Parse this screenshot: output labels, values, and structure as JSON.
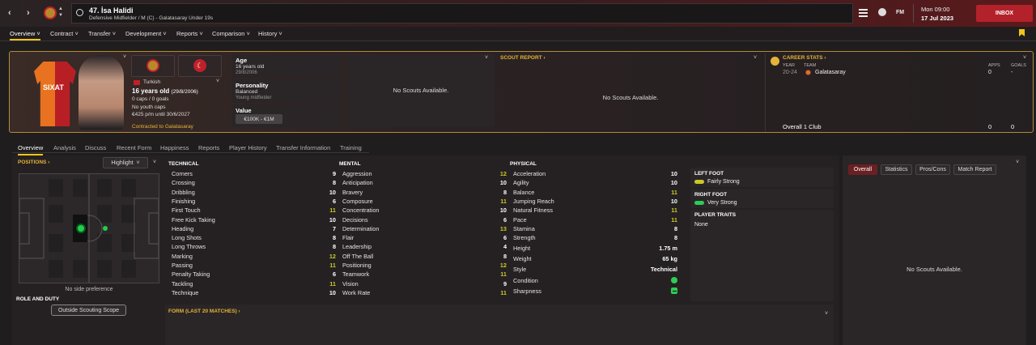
{
  "header": {
    "title": "47. İsa Halidi",
    "subtitle": "Defensive Midfielder / M (C) - Galatasaray Under 19s",
    "time": "Mon 09:00",
    "date": "17 Jul 2023",
    "inbox": "INBOX",
    "fm": "FM"
  },
  "menu": [
    "Overview",
    "Contract",
    "Transfer",
    "Development",
    "Reports",
    "Comparison",
    "History"
  ],
  "profile": {
    "nationality": "Turkish",
    "age_line": "16 years old",
    "dob_paren": "(29/8/2006)",
    "caps": "0 caps / 0 goals",
    "youth_caps": "No youth caps",
    "wage": "€425 p/m until 30/6/2027",
    "contract": "Contracted to Galatasaray",
    "shirt_text": "SIXAT"
  },
  "info": {
    "age_label": "Age",
    "age": "16 years old",
    "dob": "29/8/2006",
    "personality_label": "Personality",
    "personality": "Balanced",
    "personality_sub": "Young midfielder",
    "value_label": "Value",
    "value": "€100K - €1M"
  },
  "scouts": {
    "no_scouts": "No Scouts Available.",
    "scout_report": "SCOUT REPORT",
    "no_scouts2": "No Scouts Available."
  },
  "career": {
    "title": "CAREER STATS",
    "year_hdr": "YEAR",
    "team_hdr": "TEAM",
    "apps_hdr": "APPS",
    "goals_hdr": "GOALS",
    "year": "20-24",
    "team": "Galatasaray",
    "apps": "0",
    "goals": "-",
    "total_label": "Overall 1 Club",
    "total_apps": "0",
    "total_goals": "0"
  },
  "subtabs": [
    "Overview",
    "Analysis",
    "Discuss",
    "Recent Form",
    "Happiness",
    "Reports",
    "Player History",
    "Transfer Information",
    "Training"
  ],
  "positions": {
    "title": "POSITIONS",
    "dropdown": "Highlight",
    "side_pref": "No side preference",
    "role_title": "ROLE AND DUTY",
    "role_btn": "Outside Scouting Scope"
  },
  "technical": {
    "title": "TECHNICAL",
    "items": [
      {
        "n": "Corners",
        "v": "9"
      },
      {
        "n": "Crossing",
        "v": "8"
      },
      {
        "n": "Dribbling",
        "v": "10"
      },
      {
        "n": "Finishing",
        "v": "6"
      },
      {
        "n": "First Touch",
        "v": "11"
      },
      {
        "n": "Free Kick Taking",
        "v": "10"
      },
      {
        "n": "Heading",
        "v": "7"
      },
      {
        "n": "Long Shots",
        "v": "8"
      },
      {
        "n": "Long Throws",
        "v": "8"
      },
      {
        "n": "Marking",
        "v": "12"
      },
      {
        "n": "Passing",
        "v": "11"
      },
      {
        "n": "Penalty Taking",
        "v": "6"
      },
      {
        "n": "Tackling",
        "v": "11"
      },
      {
        "n": "Technique",
        "v": "10"
      }
    ]
  },
  "mental": {
    "title": "MENTAL",
    "items": [
      {
        "n": "Aggression",
        "v": "12"
      },
      {
        "n": "Anticipation",
        "v": "10"
      },
      {
        "n": "Bravery",
        "v": "8"
      },
      {
        "n": "Composure",
        "v": "11"
      },
      {
        "n": "Concentration",
        "v": "10"
      },
      {
        "n": "Decisions",
        "v": "6"
      },
      {
        "n": "Determination",
        "v": "13"
      },
      {
        "n": "Flair",
        "v": "6"
      },
      {
        "n": "Leadership",
        "v": "4"
      },
      {
        "n": "Off The Ball",
        "v": "8"
      },
      {
        "n": "Positioning",
        "v": "12"
      },
      {
        "n": "Teamwork",
        "v": "11"
      },
      {
        "n": "Vision",
        "v": "9"
      },
      {
        "n": "Work Rate",
        "v": "11"
      }
    ]
  },
  "physical": {
    "title": "PHYSICAL",
    "items": [
      {
        "n": "Acceleration",
        "v": "10"
      },
      {
        "n": "Agility",
        "v": "10"
      },
      {
        "n": "Balance",
        "v": "11"
      },
      {
        "n": "Jumping Reach",
        "v": "10"
      },
      {
        "n": "Natural Fitness",
        "v": "11"
      },
      {
        "n": "Pace",
        "v": "11"
      },
      {
        "n": "Stamina",
        "v": "8"
      },
      {
        "n": "Strength",
        "v": "8"
      }
    ],
    "extra": [
      {
        "n": "Height",
        "v": "1.75 m"
      },
      {
        "n": "Weight",
        "v": "65 kg"
      },
      {
        "n": "Style",
        "v": "Technical"
      },
      {
        "n": "Condition",
        "v": ""
      },
      {
        "n": "Sharpness",
        "v": ""
      }
    ]
  },
  "feet": {
    "left_title": "LEFT FOOT",
    "left": "Fairly Strong",
    "right_title": "RIGHT FOOT",
    "right": "Very Strong",
    "traits_title": "PLAYER TRAITS",
    "traits": "None"
  },
  "form": {
    "title": "FORM (LAST 20 MATCHES)"
  },
  "right_panel": {
    "tabs": [
      "Overall",
      "Statistics",
      "Pros/Cons",
      "Match Report"
    ],
    "no_scouts": "No Scouts Available."
  },
  "colors": {
    "accent": "#f0c419",
    "brand_red": "#b3222a",
    "gold_border": "#b58a38",
    "high_attr": "#c9c82a"
  }
}
